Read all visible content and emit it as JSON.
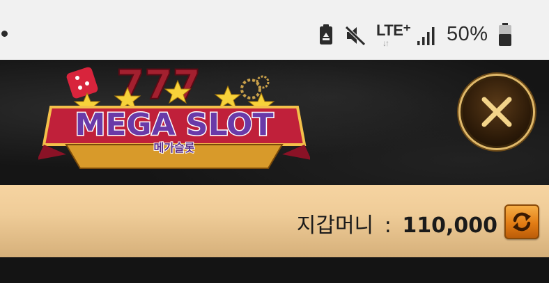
{
  "status_bar": {
    "icons": [
      "recycle-icon",
      "mute-icon",
      "lte-plus-icon",
      "signal-icon",
      "battery-icon"
    ],
    "network": "LTE⁺",
    "battery_percent": "50%"
  },
  "logo": {
    "title": "MEGA SLOT",
    "subtitle": "메가슬롯"
  },
  "header": {
    "close_icon": "close-x-icon"
  },
  "wallet": {
    "label": "지갑머니",
    "separator": ":",
    "amount": "110,000",
    "refresh_icon": "refresh-icon"
  },
  "colors": {
    "wallet_bar": "#efcc98",
    "close_ring": "#e0b96a",
    "refresh_button": "#e27c14",
    "logo_text": "#5a2e8a",
    "logo_banner": "#c0203a"
  }
}
